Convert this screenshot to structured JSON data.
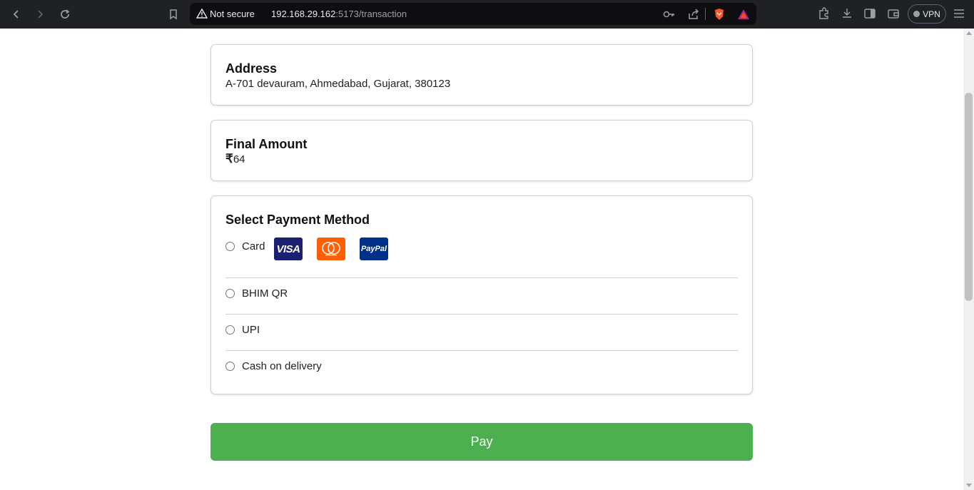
{
  "browser": {
    "not_secure": "Not secure",
    "url_host": "192.168.29.162",
    "url_path": ":5173/transaction",
    "vpn_label": "VPN"
  },
  "address": {
    "title": "Address",
    "value": "A-701 devauram, Ahmedabad, Gujarat, 380123"
  },
  "amount": {
    "title": "Final Amount",
    "currency_symbol": "₹",
    "value": "64"
  },
  "payment": {
    "title": "Select Payment Method",
    "options": [
      {
        "label": "Card"
      },
      {
        "label": "BHIM QR"
      },
      {
        "label": "UPI"
      },
      {
        "label": "Cash on delivery"
      }
    ],
    "brands": {
      "visa": "VISA",
      "paypal": "PayPal"
    }
  },
  "pay_button": {
    "label": "Pay"
  },
  "colors": {
    "pay_green": "#4caf50",
    "visa_blue": "#1a1f71",
    "mastercard_orange": "#ff5f00",
    "paypal_blue": "#003087"
  }
}
